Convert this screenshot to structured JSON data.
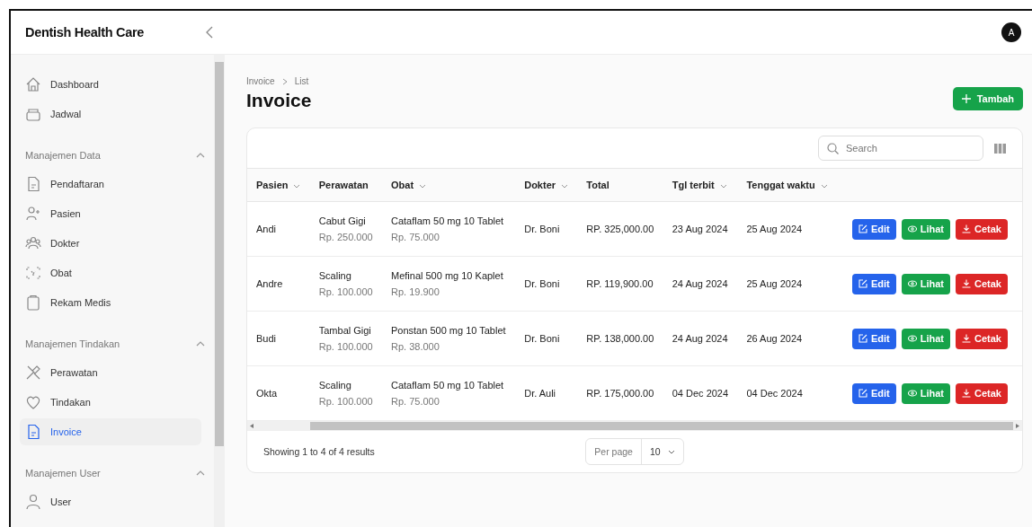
{
  "header": {
    "brand": "Dentish Health Care",
    "avatar": "A"
  },
  "sidebar": {
    "sections": [
      {
        "items": [
          {
            "label": "Dashboard",
            "selected": false
          },
          {
            "label": "Jadwal",
            "selected": false
          }
        ]
      },
      {
        "title": "Manajemen Data",
        "expanded": true,
        "items": [
          {
            "label": "Pendaftaran",
            "selected": false
          },
          {
            "label": "Pasien",
            "selected": false
          },
          {
            "label": "Dokter",
            "selected": false
          },
          {
            "label": "Obat",
            "selected": false
          },
          {
            "label": "Rekam Medis",
            "selected": false
          }
        ]
      },
      {
        "title": "Manajemen Tindakan",
        "expanded": true,
        "items": [
          {
            "label": "Perawatan",
            "selected": false
          },
          {
            "label": "Tindakan",
            "selected": false
          },
          {
            "label": "Invoice",
            "selected": true
          }
        ]
      },
      {
        "title": "Manajemen User",
        "expanded": true,
        "items": [
          {
            "label": "User",
            "selected": false
          }
        ]
      }
    ]
  },
  "breadcrumb": [
    "Invoice",
    "List"
  ],
  "title": "Invoice",
  "add_button": "Tambah",
  "search": {
    "placeholder": "Search"
  },
  "table": {
    "columns": [
      {
        "label": "Pasien",
        "sortable": true
      },
      {
        "label": "Perawatan",
        "sortable": false
      },
      {
        "label": "Obat",
        "sortable": true
      },
      {
        "label": "Dokter",
        "sortable": true
      },
      {
        "label": "Total",
        "sortable": false
      },
      {
        "label": "Tgl terbit",
        "sortable": true
      },
      {
        "label": "Tenggat waktu",
        "sortable": true
      }
    ],
    "rows": [
      {
        "pasien": "Andi",
        "perawatan": {
          "name": "Cabut Gigi",
          "price": "Rp. 250.000"
        },
        "obat": {
          "name": "Cataflam 50 mg 10 Tablet",
          "price": "Rp. 75.000"
        },
        "dokter": "Dr. Boni",
        "total": "RP. 325,000.00",
        "tgl_terbit": "23 Aug 2024",
        "tenggat": "25 Aug 2024",
        "actions": [
          {
            "kind": "edit",
            "label": "Edit"
          },
          {
            "kind": "view",
            "label": "Lihat"
          },
          {
            "kind": "print",
            "label": "Cetak"
          }
        ]
      },
      {
        "pasien": "Andre",
        "perawatan": {
          "name": "Scaling",
          "price": "Rp. 100.000"
        },
        "obat": {
          "name": "Mefinal 500 mg 10 Kaplet",
          "price": "Rp. 19.900"
        },
        "dokter": "Dr. Boni",
        "total": "RP. 119,900.00",
        "tgl_terbit": "24 Aug 2024",
        "tenggat": "25 Aug 2024",
        "actions": [
          {
            "kind": "edit",
            "label": "Edit"
          },
          {
            "kind": "view",
            "label": "Lihat"
          },
          {
            "kind": "print",
            "label": "Cetak"
          }
        ]
      },
      {
        "pasien": "Budi",
        "perawatan": {
          "name": "Tambal Gigi",
          "price": "Rp. 100.000"
        },
        "obat": {
          "name": "Ponstan 500 mg 10 Tablet",
          "price": "Rp. 38.000"
        },
        "dokter": "Dr. Boni",
        "total": "RP. 138,000.00",
        "tgl_terbit": "24 Aug 2024",
        "tenggat": "26 Aug 2024",
        "actions": [
          {
            "kind": "edit",
            "label": "Edit"
          },
          {
            "kind": "view",
            "label": "Lihat"
          },
          {
            "kind": "print",
            "label": "Cetak"
          }
        ]
      },
      {
        "pasien": "Okta",
        "perawatan": {
          "name": "Scaling",
          "price": "Rp. 100.000"
        },
        "obat": {
          "name": "Cataflam 50 mg 10 Tablet",
          "price": "Rp. 75.000"
        },
        "dokter": "Dr. Auli",
        "total": "RP. 175,000.00",
        "tgl_terbit": "04 Dec 2024",
        "tenggat": "04 Dec 2024",
        "actions": [
          {
            "kind": "edit",
            "label": "Edit"
          },
          {
            "kind": "view",
            "label": "Lihat"
          },
          {
            "kind": "print",
            "label": "Cetak"
          }
        ]
      }
    ]
  },
  "footer": {
    "summary": "Showing 1 to 4 of 4 results",
    "per_page_label": "Per page",
    "per_page": "10"
  }
}
